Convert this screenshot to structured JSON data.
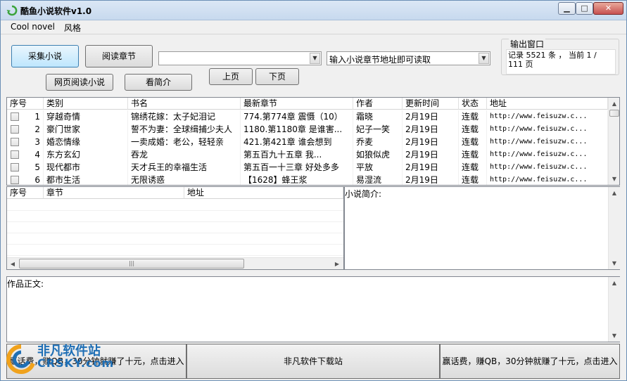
{
  "window": {
    "title": "酷鱼小说软件v1.0",
    "controls": {
      "minimize": "▁",
      "maximize": "□",
      "close": "✕"
    }
  },
  "menu": [
    "Cool novel",
    "风格"
  ],
  "toolbar": {
    "collect": "采集小说",
    "read_chapter": "阅读章节",
    "web_read": "网页阅读小说",
    "view_intro": "看简介",
    "prev_page": "上页",
    "next_page": "下页",
    "combo1_value": "",
    "combo2_value": "输入小说章节地址即可读取"
  },
  "output": {
    "title": "输出窗口",
    "text": "记录 5521 条 ， 当前 1 / 111 页"
  },
  "novel_table": {
    "columns": [
      "序号",
      "类别",
      "书名",
      "最新章节",
      "作者",
      "更新时间",
      "状态",
      "地址"
    ],
    "rows": [
      [
        "1",
        "穿越奇情",
        "锦绣花嫁：太子妃泪记",
        "774.第774章 震慑（10）",
        "霜晓",
        "2月19日",
        "连载",
        "http://www.feisuzw.c..."
      ],
      [
        "2",
        "豪门世家",
        "誓不为妻：全球缉捕少夫人",
        "1180.第1180章 是谁害...",
        "妃子一笑",
        "2月19日",
        "连载",
        "http://www.feisuzw.c..."
      ],
      [
        "3",
        "婚恋情缘",
        "一卖成婚：老公，轻轻亲",
        "421.第421章 谁会想到",
        "乔麦",
        "2月19日",
        "连载",
        "http://www.feisuzw.c..."
      ],
      [
        "4",
        "东方玄幻",
        "吞龙",
        "第五百九十五章 我...",
        "如狼似虎",
        "2月19日",
        "连载",
        "http://www.feisuzw.c..."
      ],
      [
        "5",
        "现代都市",
        "天才兵王的幸福生活",
        "第五百一十三章 好处多多",
        "平放",
        "2月19日",
        "连载",
        "http://www.feisuzw.c..."
      ],
      [
        "6",
        "都市生活",
        "无限诱惑",
        "【1628】蜂王浆",
        "易湿流",
        "2月19日",
        "连载",
        "http://www.feisuzw.c..."
      ]
    ]
  },
  "chapter_table": {
    "columns": [
      "序号",
      "章节",
      "地址"
    ]
  },
  "intro_label": "小说简介:",
  "content_label": "作品正文:",
  "footer": {
    "left": "赢话费，赚QB，30分钟就赚了十元，点击进入",
    "center": "非凡软件下载站",
    "right": "赢话费，赚QB，30分钟就赚了十元，点击进入"
  },
  "watermark": {
    "line1": "非凡软件站",
    "line2": "CRSKY.com"
  },
  "colors": {
    "accent": "#3c7fb1",
    "watermark": "#1f6fb5"
  }
}
